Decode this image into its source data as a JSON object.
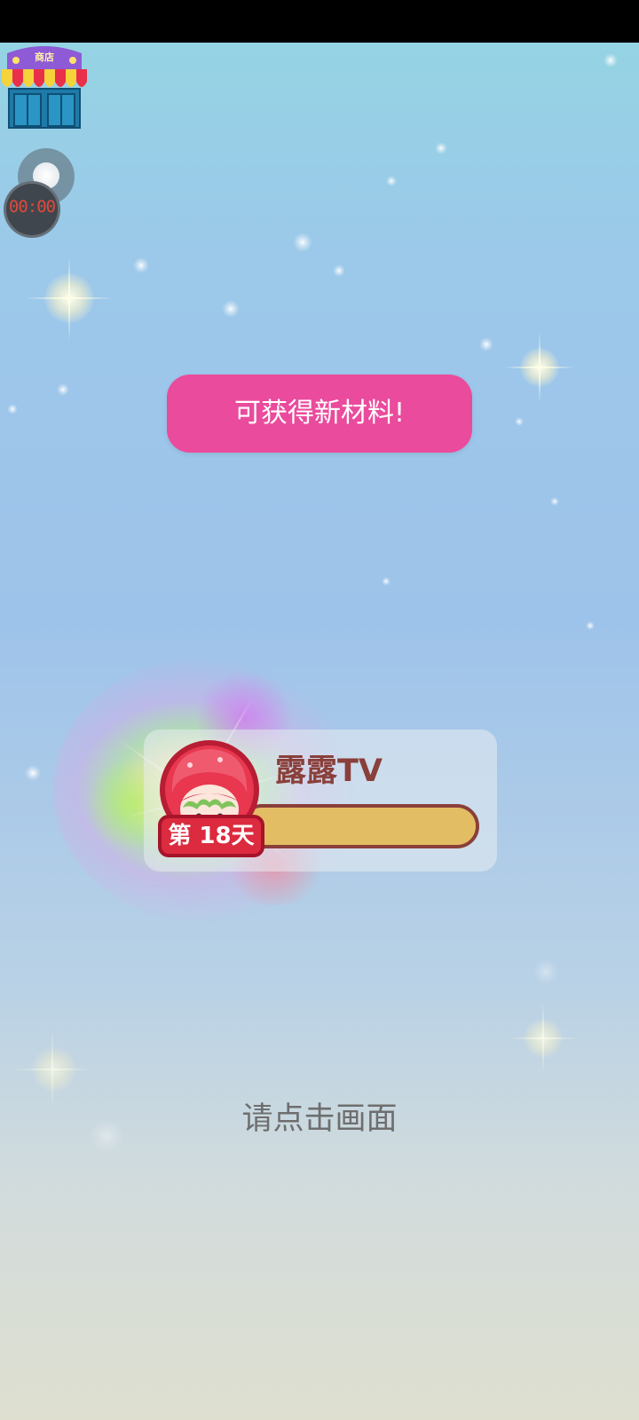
{
  "status_bar": {},
  "shop": {
    "label": "商店",
    "icon": "shop-icon"
  },
  "timer": {
    "text": "00:00"
  },
  "banner": {
    "text": "可获得新材料!"
  },
  "character_card": {
    "name": "露露TV",
    "day_label": "第 18天",
    "progress": 1.0
  },
  "hint": {
    "text": "请点击画面"
  },
  "colors": {
    "banner": "#ea4b9c",
    "name": "#8a3f3a",
    "progress_fill": "#e3bd63",
    "badge": "#dc2a3e",
    "timer_text": "#e0483c"
  }
}
